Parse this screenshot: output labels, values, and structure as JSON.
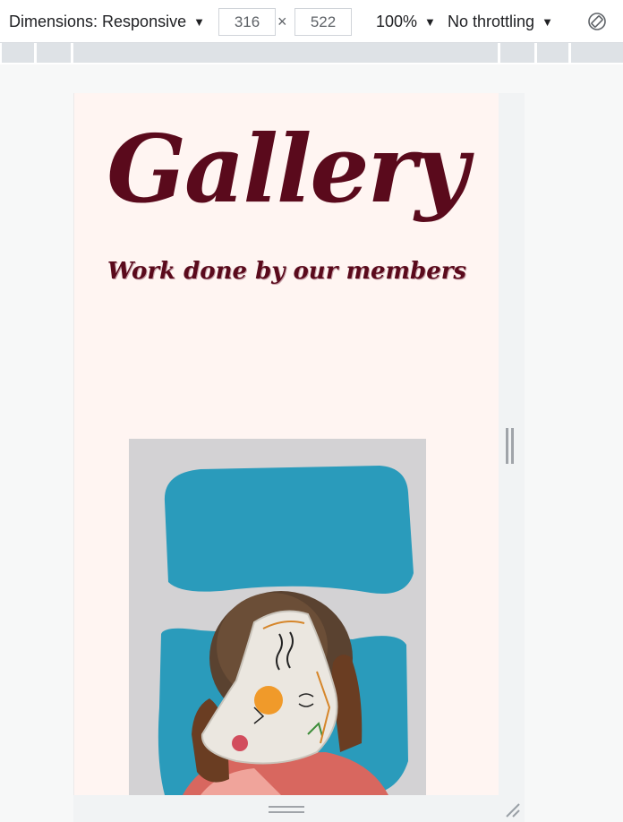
{
  "toolbar": {
    "dimensions_label": "Dimensions: Responsive",
    "width_value": "316",
    "times_symbol": "×",
    "height_value": "522",
    "zoom_label": "100%",
    "throttling_label": "No throttling",
    "caret": "▼",
    "rotate_icon": "rotate-icon"
  },
  "page": {
    "title": "Gallery",
    "subtitle": "Work done by our members",
    "background_color": "#fff5f2",
    "title_color": "#5a0a1c"
  },
  "photo": {
    "icon": "artwork-photo"
  }
}
